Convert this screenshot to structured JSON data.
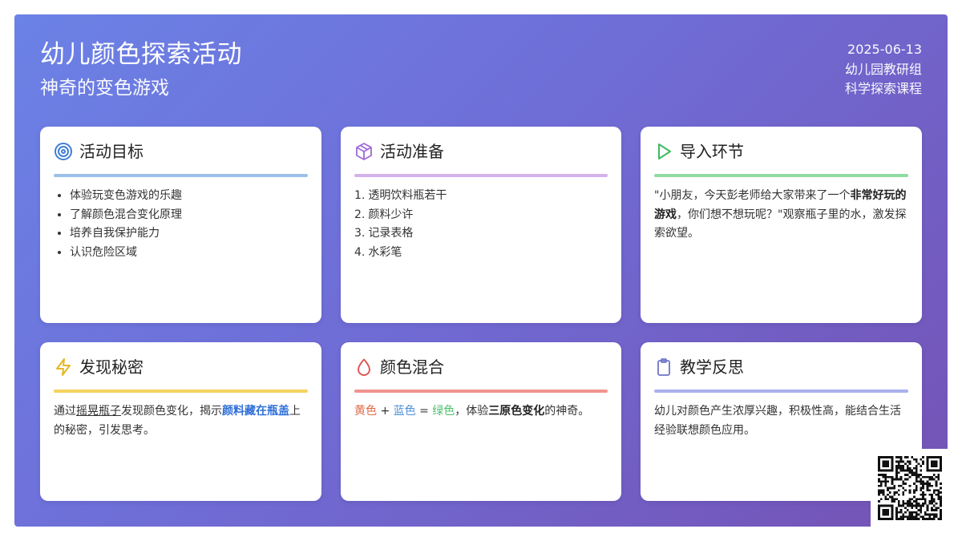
{
  "header": {
    "title": "幼儿颜色探索活动",
    "subtitle": "神奇的变色游戏",
    "date": "2025-06-13",
    "group": "幼儿园教研组",
    "course": "科学探索课程"
  },
  "cards": {
    "goals": {
      "icon": "target-icon",
      "title": "活动目标",
      "accent": "#9bc0ea",
      "items": [
        "体验玩变色游戏的乐趣",
        "了解颜色混合变化原理",
        "培养自我保护能力",
        "认识危险区域"
      ]
    },
    "prep": {
      "icon": "box-icon",
      "title": "活动准备",
      "accent": "#d4b3ec",
      "items": [
        {
          "num": "1.",
          "text": "透明饮料瓶若干"
        },
        {
          "num": "2.",
          "text": "颜料少许"
        },
        {
          "num": "3.",
          "text": "记录表格"
        },
        {
          "num": "4.",
          "text": "水彩笔"
        }
      ]
    },
    "intro": {
      "icon": "play-icon",
      "title": "导入环节",
      "accent": "#8fdca3",
      "text_a": "\"小朋友，今天彭老师给大家带来了一个",
      "text_b": "非常好玩的游戏",
      "text_c": "，你们想不想玩呢？\"观察瓶子里的水，激发探索欲望。"
    },
    "discover": {
      "icon": "lightning-icon",
      "title": "发现秘密",
      "accent": "#f4d35e",
      "text_a": "通过",
      "text_b": "摇晃瓶子",
      "text_c": "发现颜色变化，揭示",
      "text_d": "颜料藏在瓶盖",
      "text_e": "上的秘密，引发思考。"
    },
    "mix": {
      "icon": "drop-icon",
      "title": "颜色混合",
      "accent": "#f0948f",
      "yellow": "黄色",
      "plus": "+",
      "blue": "蓝色",
      "equals": "=",
      "green": "绿色",
      "text_a": "，体验",
      "text_b": "三原色变化",
      "text_c": "的神奇。"
    },
    "reflect": {
      "icon": "clipboard-icon",
      "title": "教学反思",
      "accent": "#a9b1ef",
      "text": "幼儿对颜色产生浓厚兴趣，积极性高，能结合生活经验联想颜色应用。"
    }
  },
  "colors": {
    "target": "#3f7fd6",
    "box": "#a06ad8",
    "play": "#3dbb62",
    "lightning": "#e4b723",
    "drop": "#e05a55",
    "clipboard": "#6d74c8"
  },
  "qr": {
    "icon": "qr-code-icon"
  }
}
